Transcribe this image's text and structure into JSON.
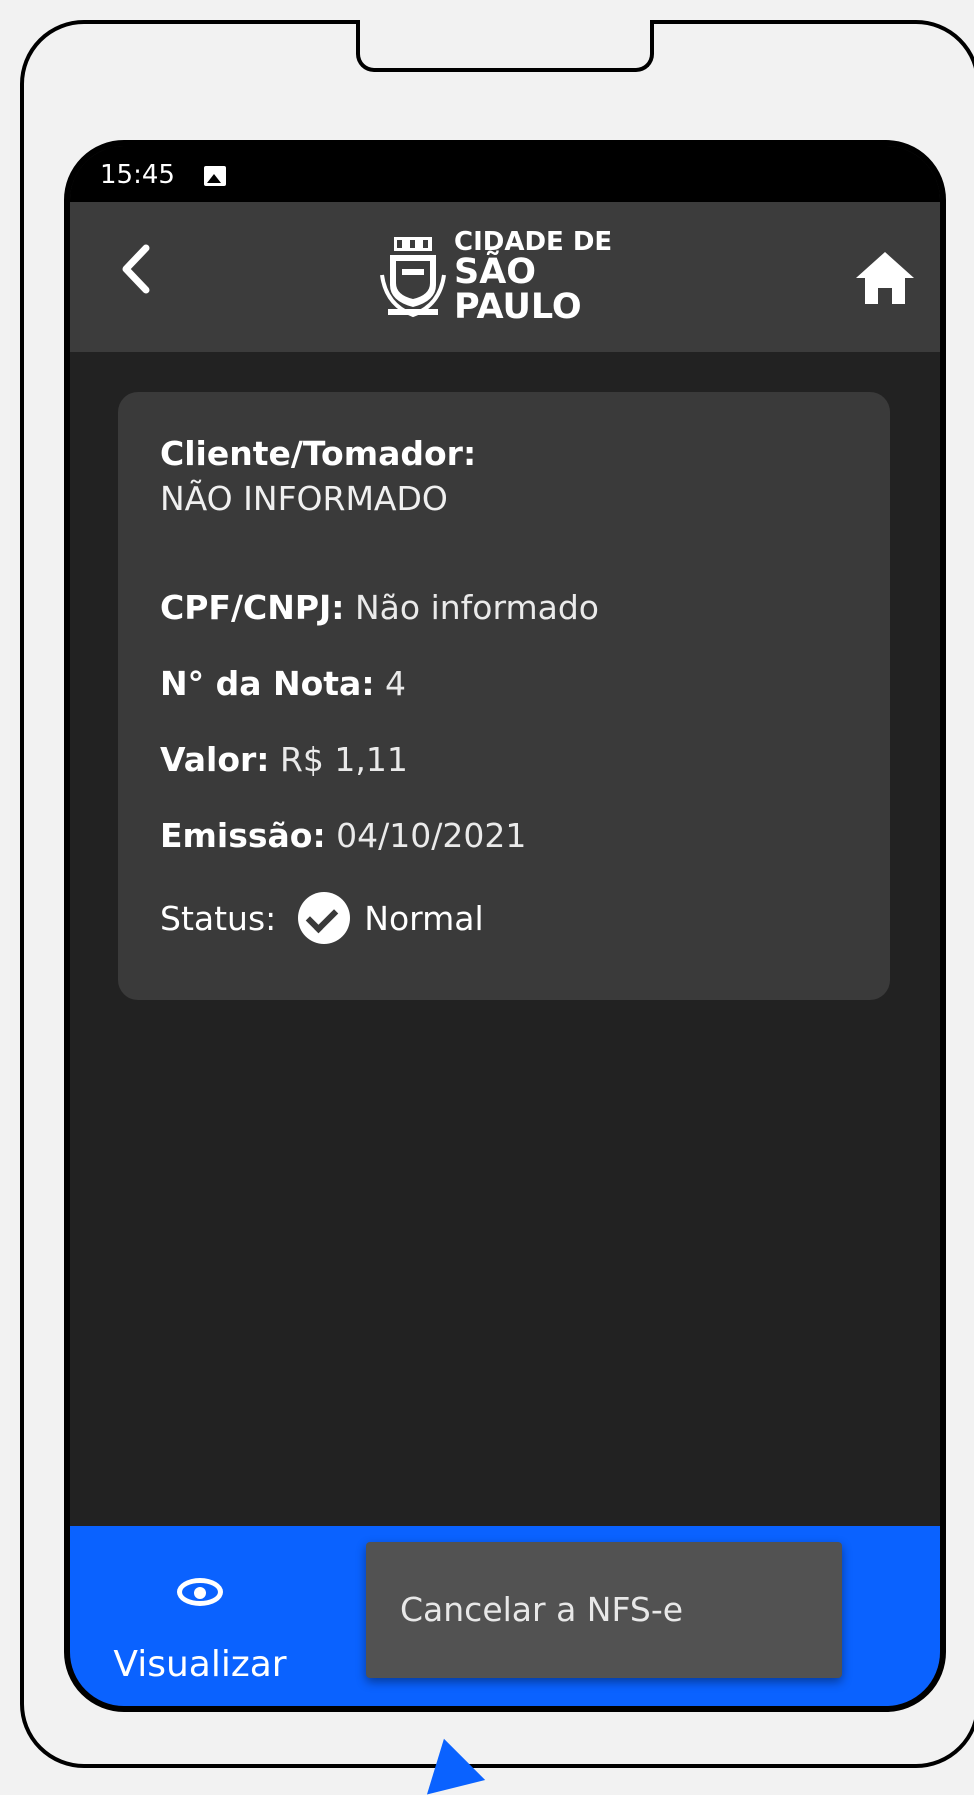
{
  "status_bar": {
    "time": "15:45"
  },
  "header": {
    "logo_line1": "CIDADE DE",
    "logo_line2": "SÃO PAULO"
  },
  "card": {
    "client_label": "Cliente/Tomador:",
    "client_value": "NÃO INFORMADO",
    "cpf_label": "CPF/CNPJ:",
    "cpf_value": "Não informado",
    "nota_label": "N° da Nota:",
    "nota_value": "4",
    "valor_label": "Valor:",
    "valor_value": "R$ 1,11",
    "emissao_label": "Emissão:",
    "emissao_value": "04/10/2021",
    "status_label": "Status:",
    "status_value": "Normal"
  },
  "bottom_bar": {
    "view_label": "Visualizar",
    "menu_item": "Cancelar a NFS-e"
  },
  "colors": {
    "accent": "#0a62ff",
    "header_bg": "#3c3c3c",
    "card_bg": "#3a3a3a",
    "screen_bg": "#222222"
  }
}
